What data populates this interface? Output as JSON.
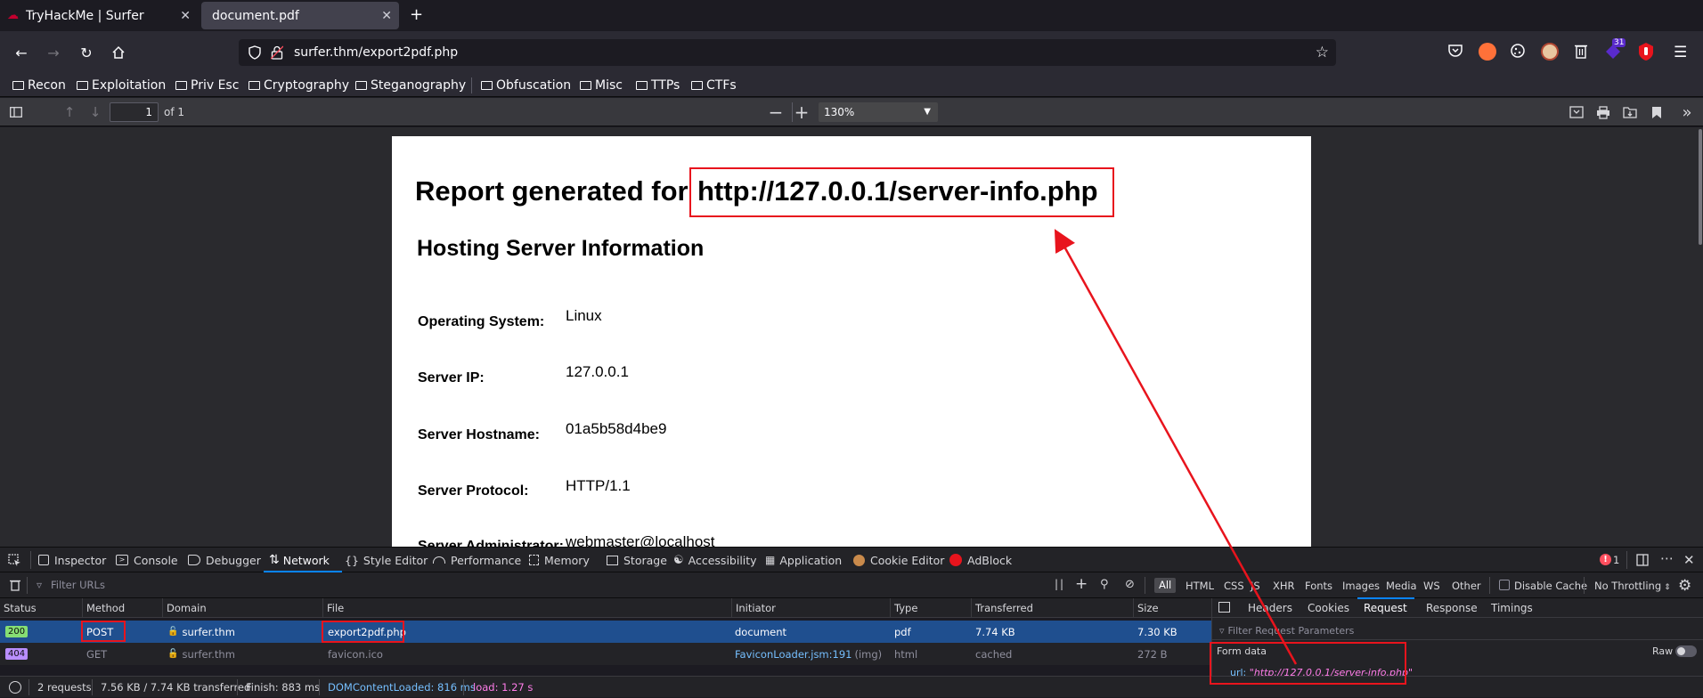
{
  "tabs": [
    {
      "title": "TryHackMe | Surfer",
      "selected": false
    },
    {
      "title": "document.pdf",
      "selected": true
    }
  ],
  "url": "surfer.thm/export2pdf.php",
  "bookmarks": [
    "Recon",
    "Exploitation",
    "Priv Esc",
    "Cryptography",
    "Steganography",
    "Obfuscation",
    "Misc",
    "TTPs",
    "CTFs"
  ],
  "pdf_toolbar": {
    "page_value": "1",
    "page_of": "of 1",
    "zoom": "130%"
  },
  "pdf": {
    "heading_prefix": "Report generated for",
    "heading_url": "http://127.0.0.1/server-info.php",
    "section_title": "Hosting Server Information",
    "fields": [
      {
        "label": "Operating System:",
        "value": "Linux"
      },
      {
        "label": "Server IP:",
        "value": "127.0.0.1"
      },
      {
        "label": "Server Hostname:",
        "value": "01a5b58d4be9"
      },
      {
        "label": "Server Protocol:",
        "value": "HTTP/1.1"
      },
      {
        "label": "Server Administrator:",
        "value": "webmaster@localhost"
      }
    ]
  },
  "devtools": {
    "tabs": [
      "Inspector",
      "Console",
      "Debugger",
      "Network",
      "Style Editor",
      "Performance",
      "Memory",
      "Storage",
      "Accessibility",
      "Application",
      "Cookie Editor",
      "AdBlock"
    ],
    "selected_tab": "Network",
    "error_count": "1",
    "filter_placeholder": "Filter URLs",
    "type_filters": [
      "All",
      "HTML",
      "CSS",
      "JS",
      "XHR",
      "Fonts",
      "Images",
      "Media",
      "WS",
      "Other"
    ],
    "disable_cache": "Disable Cache",
    "throttling": "No Throttling",
    "columns": [
      "Status",
      "Method",
      "Domain",
      "File",
      "Initiator",
      "Type",
      "Transferred",
      "Size"
    ],
    "rows": [
      {
        "status": "200",
        "method": "POST",
        "domain": "surfer.thm",
        "file": "export2pdf.php",
        "initiator": "document",
        "type": "pdf",
        "transferred": "7.74 KB",
        "size": "7.30 KB"
      },
      {
        "status": "404",
        "method": "GET",
        "domain": "surfer.thm",
        "file": "favicon.ico",
        "initiator": "FaviconLoader.jsm:191",
        "initiator_suffix": "(img)",
        "type": "html",
        "transferred": "cached",
        "size": "272 B"
      }
    ],
    "side_tabs": [
      "Headers",
      "Cookies",
      "Request",
      "Response",
      "Timings"
    ],
    "side_selected": "Request",
    "side_filter_placeholder": "Filter Request Parameters",
    "form_data_label": "Form data",
    "raw_label": "Raw",
    "form_key": "url:",
    "form_value": "\"http://127.0.0.1/server-info.php\"",
    "status": {
      "requests": "2 requests",
      "transferred": "7.56 KB / 7.74 KB transferred",
      "finish": "Finish: 883 ms",
      "dcl": "DOMContentLoaded: 816 ms",
      "load": "load: 1.27 s"
    }
  },
  "colors": {
    "accent": "#0a84ff",
    "annotation": "#e8141d",
    "selected_row": "#1f4f8f",
    "status_ok": "#86de74",
    "status_404": "#b98eff"
  }
}
